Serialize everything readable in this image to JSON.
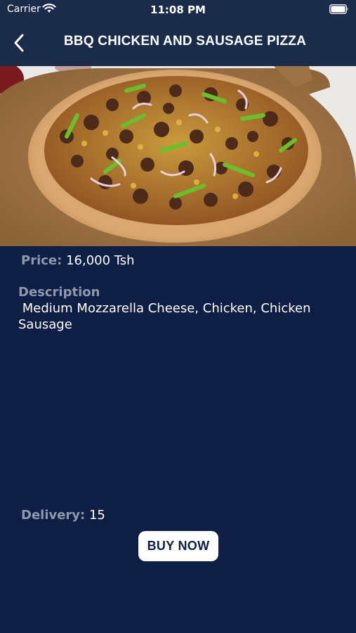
{
  "status_bar": {
    "carrier": "Carrier",
    "time": "11:08 PM"
  },
  "nav": {
    "title": "BBQ CHICKEN AND SAUSAGE PIZZA",
    "back_icon": "chevron-left-icon"
  },
  "product": {
    "image_icon": "pizza-photo",
    "price_label": "Price:",
    "price_value": "16,000 Tsh",
    "description_label": "Description",
    "description_text": " Medium Mozzarella Cheese, Chicken, Chicken Sausage",
    "delivery_label": "Delivery:",
    "delivery_value": "15"
  },
  "actions": {
    "buy_label": "BUY NOW"
  },
  "colors": {
    "background": "#0f1e45",
    "nav": "#1b2b4a",
    "label": "#8f98ad",
    "button": "#ffffff"
  }
}
